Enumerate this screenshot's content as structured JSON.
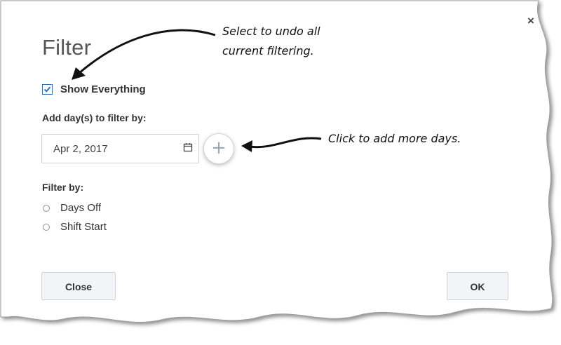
{
  "dialog": {
    "title": "Filter",
    "close_symbol": "×",
    "show_everything": {
      "label": "Show Everything",
      "checked": true
    },
    "add_days_label": "Add day(s) to filter by:",
    "date_value": "Apr 2, 2017",
    "add_button_symbol": "+",
    "filter_by_label": "Filter by:",
    "options": [
      {
        "label": "Days Off",
        "selected": false
      },
      {
        "label": "Shift Start",
        "selected": false
      }
    ],
    "close_button": "Close",
    "ok_button": "OK"
  },
  "annotations": {
    "undo_line1": "Select to undo all",
    "undo_line2": "current filtering.",
    "add_days": "Click to add more days."
  },
  "icons": {
    "checkbox": "check-icon",
    "date": "calendar-icon",
    "add": "plus-icon",
    "close": "close-icon"
  },
  "colors": {
    "accent": "#2c6fb5",
    "button_bg": "#f2f4f7",
    "border": "#cfd3d8"
  }
}
